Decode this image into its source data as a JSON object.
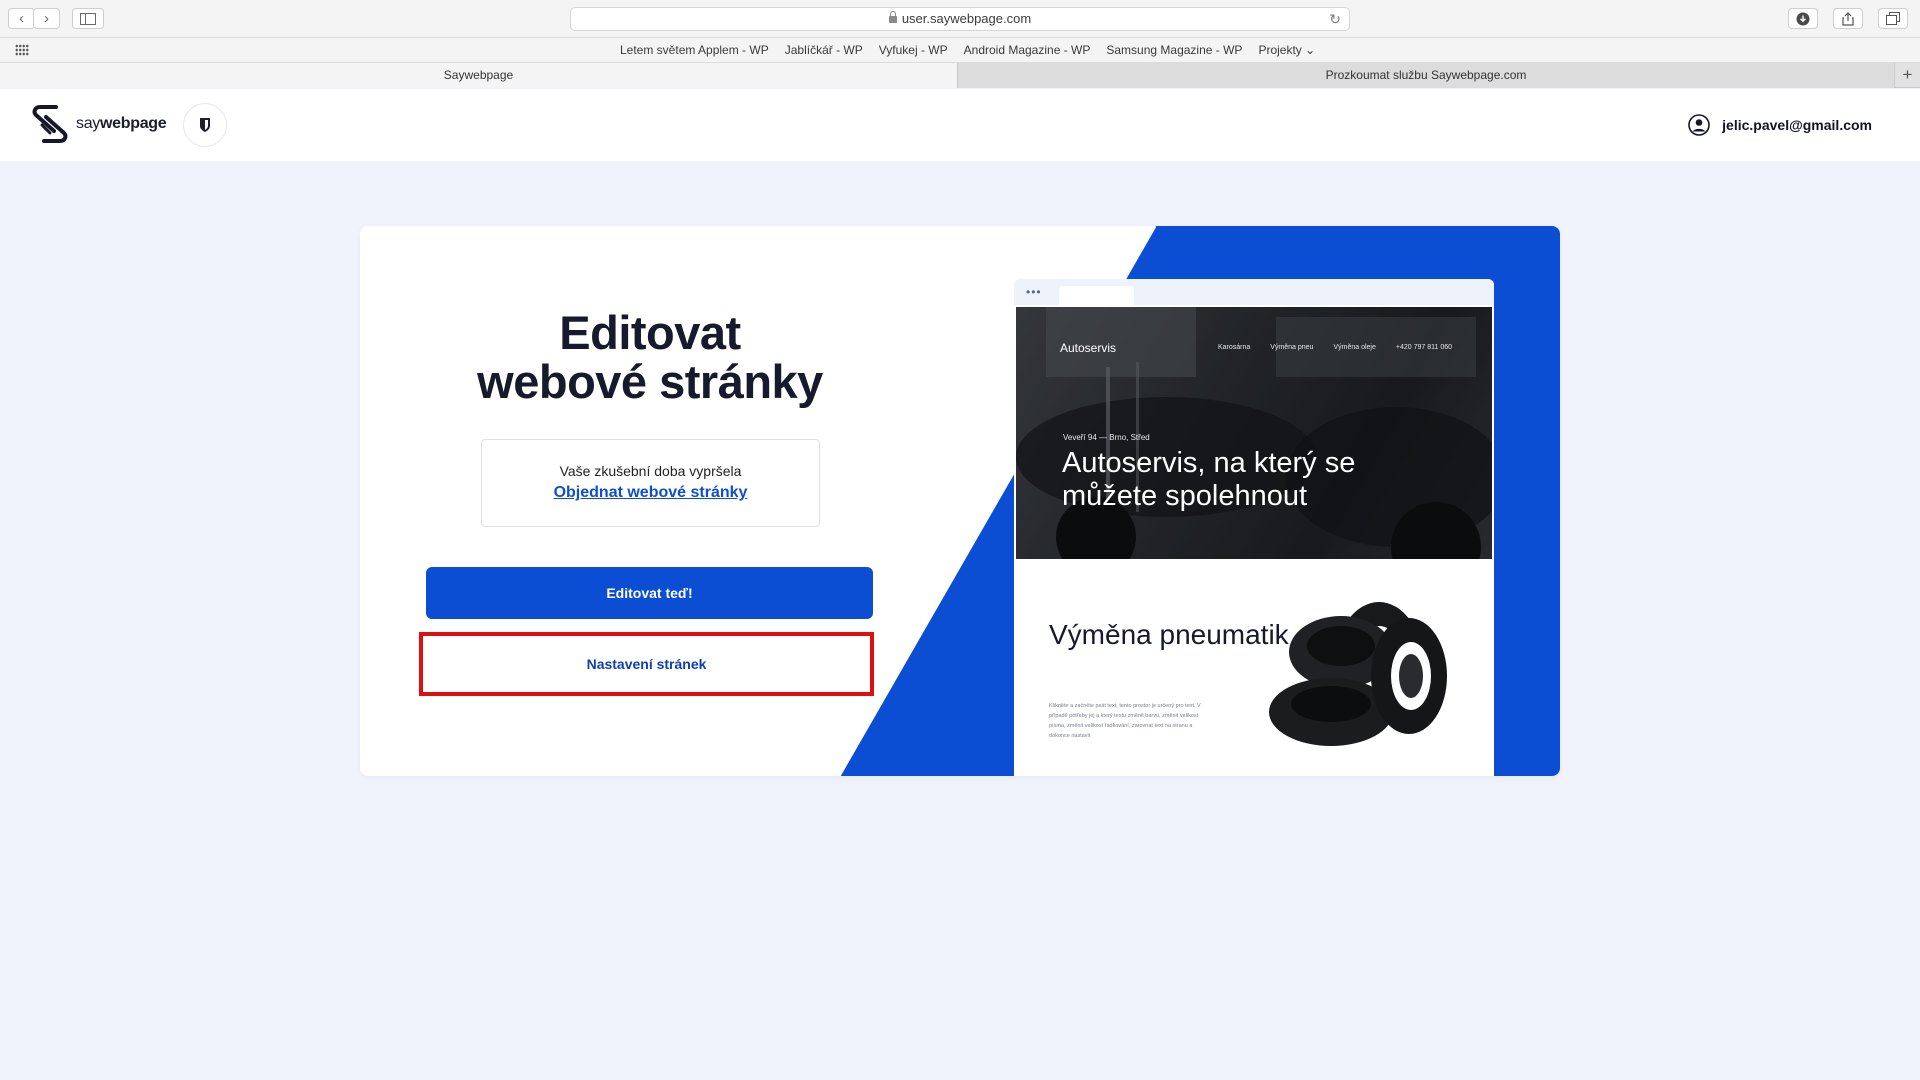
{
  "browser": {
    "url": "user.saywebpage.com",
    "back_glyph": "‹",
    "forward_glyph": "›",
    "reload_glyph": "↻",
    "bookmarks": [
      "Letem světem Applem - WP",
      "Jablíčkář - WP",
      "Vyfukej - WP",
      "Android Magazine - WP",
      "Samsung Magazine - WP",
      "Projekty ⌄"
    ],
    "tabs": {
      "active": "Saywebpage",
      "inactive": "Prozkoumat službu Saywebpage.com",
      "add": "+"
    },
    "icons": [
      "sidebar-icon",
      "download-icon",
      "share-icon",
      "tabs-overview-icon",
      "grid-icon",
      "lock-icon"
    ]
  },
  "header": {
    "logo_say": "say",
    "logo_webpage": "webpage",
    "user_email": "jelic.pavel@gmail.com"
  },
  "main": {
    "title_line1": "Editovat",
    "title_line2": "webové stránky",
    "trial_notice": "Vaše zkušební doba vypršela",
    "order_link": "Objednat webové stránky",
    "edit_button": "Editovat teď!",
    "settings_button": "Nastavení stránek"
  },
  "preview": {
    "dots": "•••",
    "brand": "Autoservis",
    "nav": [
      "Karosárna",
      "Výměna pneu",
      "Výměna oleje",
      "+420 797 811 060"
    ],
    "address": "Veveří 94 — Brno, Střed",
    "hero_title": "Autoservis, na který se můžete spolehnout",
    "section_title": "Výměna pneumatik",
    "section_text": "Klikněte a začněte psát text, tento prostor je určený pro text. V případě potřeby jej a který textu změnit barvu, změnit velikost písma, změnit velikost řádkování, zarovnat text na stranu a dokonce nastavit"
  },
  "colors": {
    "accent_blue": "#0b4ed3",
    "highlight_red": "#e00f0f",
    "page_bg": "#f0f3fc"
  }
}
